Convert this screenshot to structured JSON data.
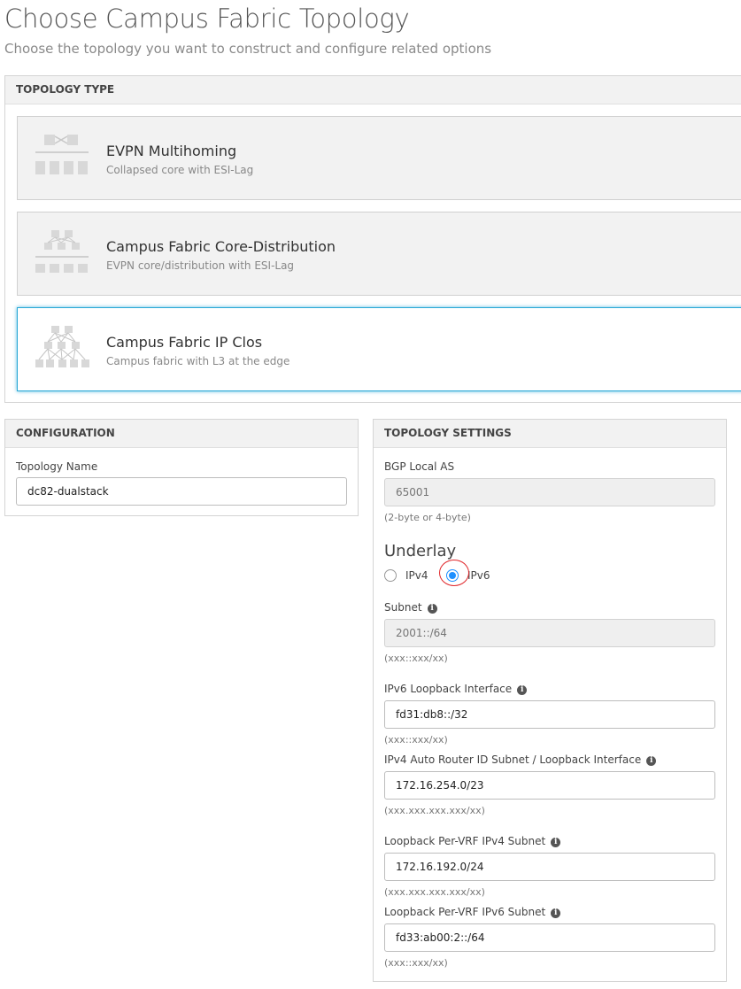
{
  "page": {
    "title": "Choose Campus Fabric Topology",
    "subtitle": "Choose the topology you want to construct and configure related options"
  },
  "topology_type": {
    "header": "TOPOLOGY TYPE",
    "options": [
      {
        "title": "EVPN Multihoming",
        "description": "Collapsed core with ESI-Lag",
        "icon": "evpn-multihoming-icon",
        "selected": false
      },
      {
        "title": "Campus Fabric Core-Distribution",
        "description": "EVPN core/distribution with ESI-Lag",
        "icon": "core-distribution-icon",
        "selected": false
      },
      {
        "title": "Campus Fabric IP Clos",
        "description": "Campus fabric with L3 at the edge",
        "icon": "ip-clos-icon",
        "selected": true
      }
    ]
  },
  "configuration": {
    "header": "CONFIGURATION",
    "topology_name_label": "Topology Name",
    "topology_name_value": "dc82-dualstack"
  },
  "topology_settings": {
    "header": "TOPOLOGY SETTINGS",
    "bgp_local_as_label": "BGP Local AS",
    "bgp_local_as_placeholder": "65001",
    "bgp_local_as_hint": "(2-byte or 4-byte)",
    "underlay_title": "Underlay",
    "underlay_options": [
      {
        "label": "IPv4",
        "checked": false
      },
      {
        "label": "IPv6",
        "checked": true
      }
    ],
    "subnet_label": "Subnet",
    "subnet_placeholder": "2001::/64",
    "subnet_hint": "(xxx::xxx/xx)",
    "ipv6_loopback_label": "IPv6 Loopback Interface",
    "ipv6_loopback_value": "fd31:db8::/32",
    "ipv6_loopback_hint": "(xxx::xxx/xx)",
    "ipv4_router_id_label": "IPv4 Auto Router ID Subnet / Loopback Interface",
    "ipv4_router_id_value": "172.16.254.0/23",
    "ipv4_router_id_hint": "(xxx.xxx.xxx.xxx/xx)",
    "vrf_ipv4_label": "Loopback Per-VRF IPv4 Subnet",
    "vrf_ipv4_value": "172.16.192.0/24",
    "vrf_ipv4_hint": "(xxx.xxx.xxx.xxx/xx)",
    "vrf_ipv6_label": "Loopback Per-VRF IPv6 Subnet",
    "vrf_ipv6_value": "fd33:ab00:2::/64",
    "vrf_ipv6_hint": "(xxx::xxx/xx)",
    "info_glyph": "i"
  },
  "colors": {
    "accent": "#28a8d6",
    "radio_checked": "#1e90ff",
    "annotation_circle": "#e0262a"
  }
}
